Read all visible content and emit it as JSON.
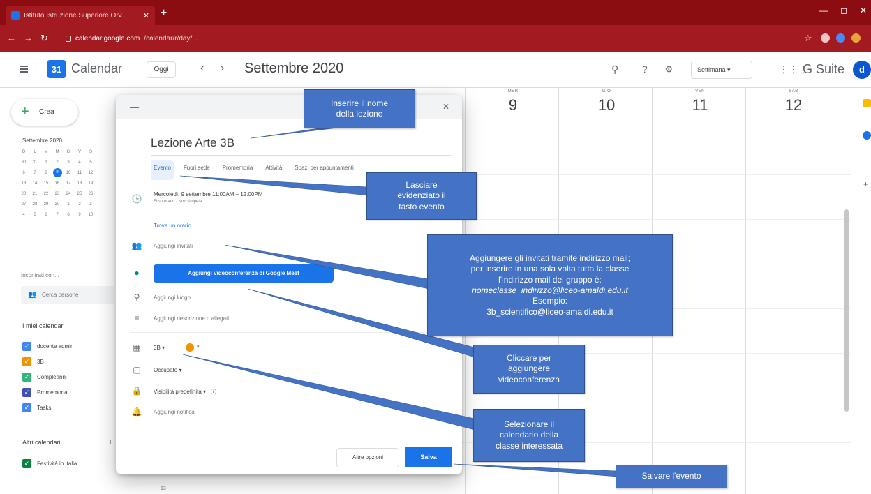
{
  "colors": {
    "chrome_red": "#8b0d12",
    "accent_blue": "#1a73e8",
    "callout_blue": "#4472c4",
    "event_orange": "#f09300"
  },
  "browser": {
    "tab_title": "Istituto Istruzione Superiore Orv...",
    "url_host": "calendar.google.com",
    "url_path": "/calendar/r/day/..."
  },
  "header": {
    "app_name": "Calendar",
    "today_label": "Oggi",
    "month_title": "Settembre 2020",
    "view_label": "Settimana",
    "gsuite_label": "G Suite",
    "avatar_letter": "d",
    "icons": [
      "search-icon",
      "help-icon",
      "settings-icon",
      "apps-icon"
    ]
  },
  "sidebar": {
    "create_label": "Crea",
    "mini_month_title": "Settembre 2020",
    "mini_weekdays": [
      "D",
      "L",
      "M",
      "M",
      "G",
      "V",
      "S"
    ],
    "mini_weeks": [
      [
        "30",
        "31",
        "1",
        "2",
        "3",
        "4",
        "5"
      ],
      [
        "6",
        "7",
        "8",
        "9",
        "10",
        "11",
        "12"
      ],
      [
        "13",
        "14",
        "15",
        "16",
        "17",
        "18",
        "19"
      ],
      [
        "20",
        "21",
        "22",
        "23",
        "24",
        "25",
        "26"
      ],
      [
        "27",
        "28",
        "29",
        "30",
        "1",
        "2",
        "3"
      ],
      [
        "4",
        "5",
        "6",
        "7",
        "8",
        "9",
        "10"
      ]
    ],
    "meet_with_label": "Incontrati con...",
    "search_people_placeholder": "Cerca persone",
    "my_calendars_title": "I miei calendari",
    "my_calendars": [
      {
        "label": "docente admin",
        "color": "#4285f4"
      },
      {
        "label": "3B",
        "color": "#f09300"
      },
      {
        "label": "Compleanni",
        "color": "#33b679"
      },
      {
        "label": "Promemoria",
        "color": "#3f51b5"
      },
      {
        "label": "Tasks",
        "color": "#4285f4"
      }
    ],
    "other_calendars_title": "Altri calendari",
    "other_calendars": [
      {
        "label": "Festività in Italia",
        "color": "#0b8043"
      }
    ]
  },
  "week": {
    "days": [
      {
        "dow": "MER",
        "num": "9"
      },
      {
        "dow": "GIO",
        "num": "10"
      },
      {
        "dow": "VEN",
        "num": "11"
      },
      {
        "dow": "SAB",
        "num": "12"
      }
    ],
    "time_label": "13"
  },
  "dialog": {
    "event_title": "Lezione Arte 3B",
    "tabs": [
      "Evento",
      "Fuori sede",
      "Promemoria",
      "Attività",
      "Spazi per appuntamenti"
    ],
    "active_tab": "Evento",
    "datetime": "Mercoledì, 9 settembre   11:00AM  –  12:00PM",
    "timezone_note": "Fuso orario · Non si ripete",
    "find_time": "Trova un orario",
    "add_guests": "Aggiungi invitati",
    "meet_button": "Aggiungi videoconferenza di Google Meet",
    "add_location": "Aggiungi luogo",
    "add_description": "Aggiungi descrizione o allegati",
    "calendar_value": "3B",
    "busy_value": "Occupato",
    "visibility_value": "Visibilità predefinita",
    "add_notification": "Aggiungi notifica",
    "more_options": "Altre opzioni",
    "save": "Salva"
  },
  "callouts": {
    "title": [
      "Inserire il nome",
      "della lezione"
    ],
    "event_tab": [
      "Lasciare",
      "evidenziato il",
      "tasto evento"
    ],
    "guests": [
      "Aggiungere gli invitati tramite indirizzo mail;",
      "per inserire in una sola volta tutta la classe",
      "l'indirizzo mail del gruppo è:",
      "nomeclasse_indirizzo@liceo-amaldi.edu.it",
      "Esempio:",
      "3b_scientifico@liceo-amaldi.edu.it"
    ],
    "meet": [
      "Cliccare per",
      "aggiungere",
      "videoconferenza"
    ],
    "calendar": [
      "Selezionare il",
      "calendario della",
      "classe interessata"
    ],
    "save": [
      "Salvare l'evento"
    ]
  }
}
